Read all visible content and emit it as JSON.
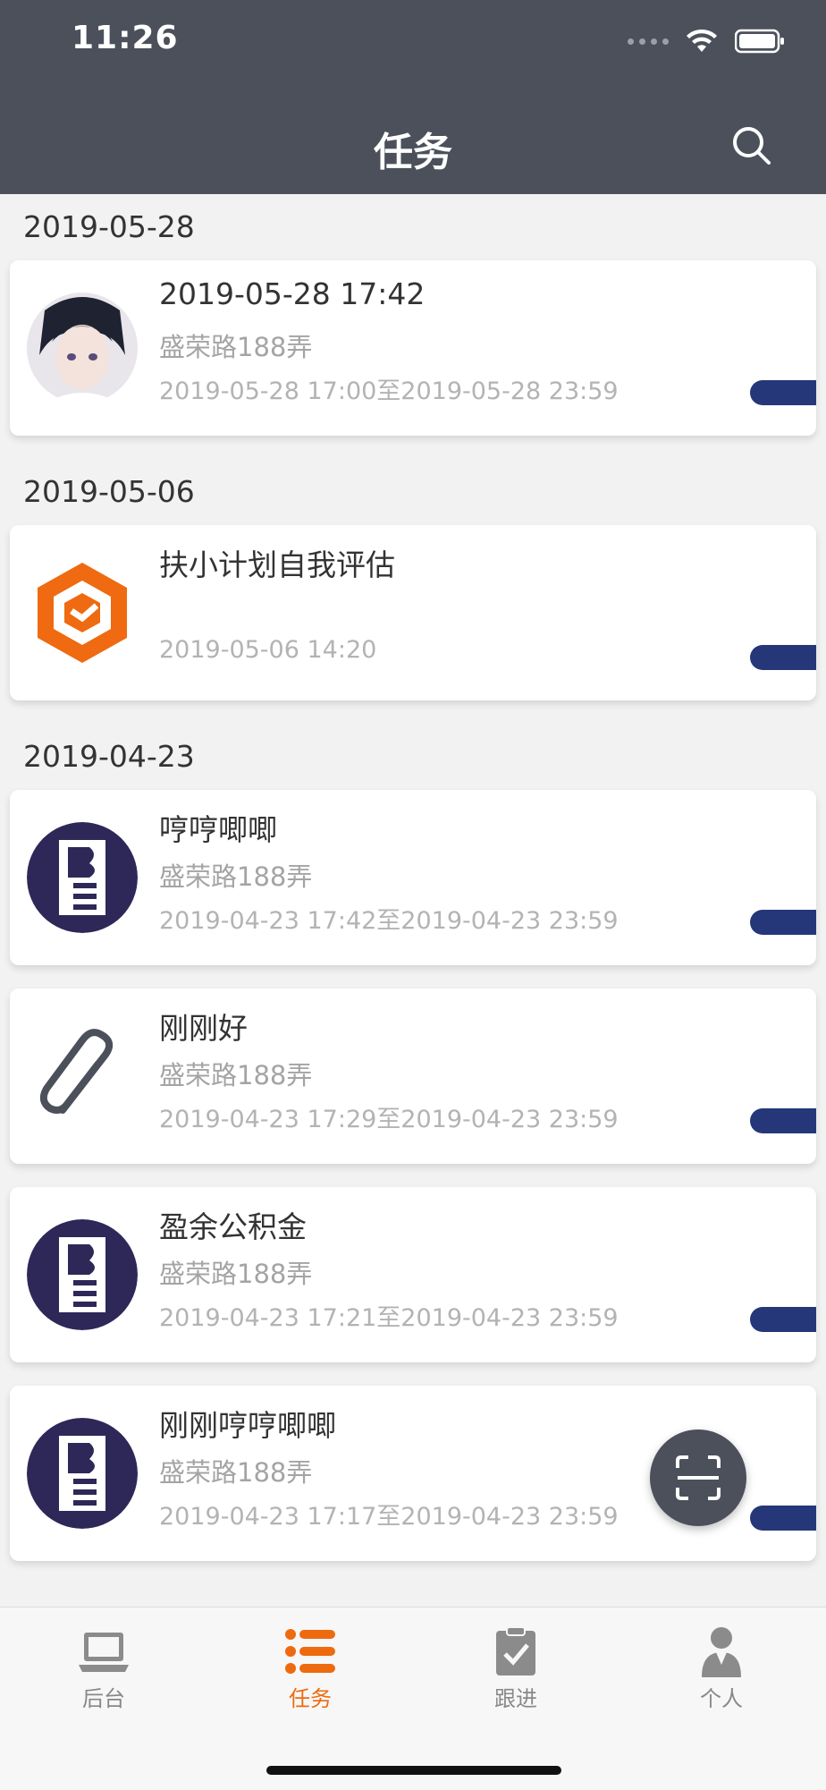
{
  "status_bar": {
    "time": "11:26"
  },
  "header": {
    "title": "任务"
  },
  "groups": [
    {
      "date": "2019-05-28",
      "items": [
        {
          "title": "2019-05-28 17:42",
          "subtitle": "盛荣路188弄",
          "time": "2019-05-28 17:00至2019-05-28 23:59",
          "avatar": "anime-portrait"
        }
      ]
    },
    {
      "date": "2019-05-06",
      "items": [
        {
          "title": "扶小计划自我评估",
          "subtitle": "",
          "time": "2019-05-06 14:20",
          "avatar": "orange-hexagon-logo"
        }
      ]
    },
    {
      "date": "2019-04-23",
      "items": [
        {
          "title": "哼哼唧唧",
          "subtitle": "盛荣路188弄",
          "time": "2019-04-23 17:42至2019-04-23 23:59",
          "avatar": "ble-logo"
        },
        {
          "title": "刚刚好",
          "subtitle": "盛荣路188弄",
          "time": "2019-04-23 17:29至2019-04-23 23:59",
          "avatar": "paperclip"
        },
        {
          "title": "盈余公积金",
          "subtitle": "盛荣路188弄",
          "time": "2019-04-23 17:21至2019-04-23 23:59",
          "avatar": "ble-logo"
        },
        {
          "title": "刚刚哼哼唧唧",
          "subtitle": "盛荣路188弄",
          "time": "2019-04-23 17:17至2019-04-23 23:59",
          "avatar": "ble-logo"
        }
      ]
    }
  ],
  "tabbar": {
    "tabs": [
      {
        "label": "后台",
        "icon": "laptop-icon",
        "active": false
      },
      {
        "label": "任务",
        "icon": "list-icon",
        "active": true
      },
      {
        "label": "跟进",
        "icon": "clipboard-check-icon",
        "active": false
      },
      {
        "label": "个人",
        "icon": "person-icon",
        "active": false
      }
    ]
  },
  "colors": {
    "header_bg": "#4b505b",
    "accent": "#ee6a0f",
    "status_pill": "#253779"
  }
}
